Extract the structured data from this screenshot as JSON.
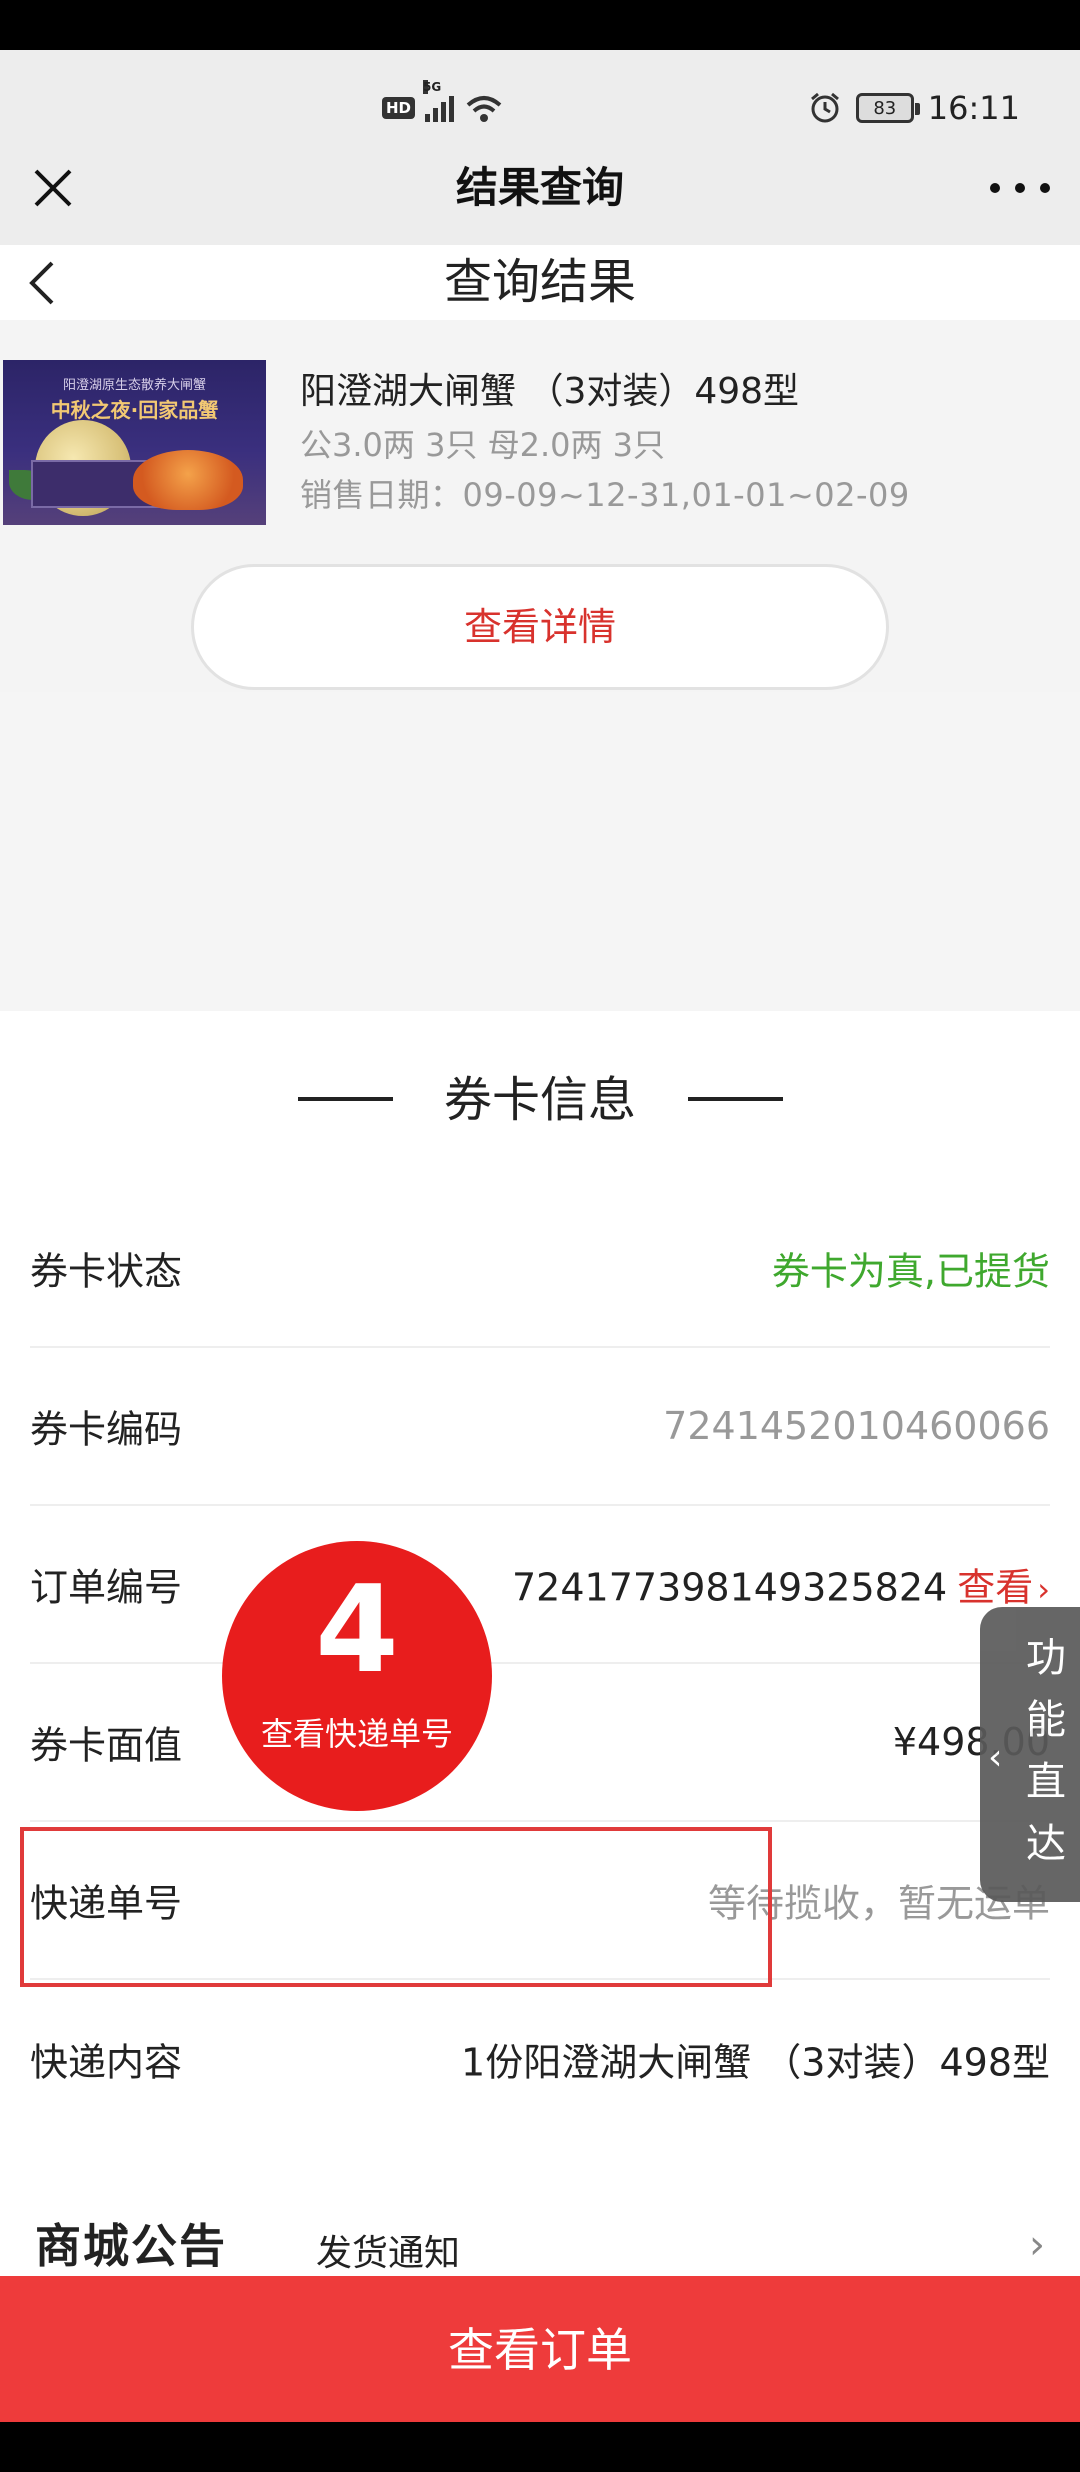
{
  "status_bar": {
    "hd": "HD",
    "network": "5G",
    "battery": "83",
    "time": "16:11"
  },
  "wechat_nav": {
    "title": "结果查询"
  },
  "page": {
    "title": "查询结果"
  },
  "product": {
    "image_subtitle": "阳澄湖原生态散养大闸蟹",
    "image_heading": "中秋之夜·回家品蟹",
    "name": "阳澄湖大闸蟹 （3对装）498型",
    "spec": "公3.0两 3只 母2.0两 3只",
    "sale_date": "销售日期：09-09~12-31,01-01~02-09",
    "detail_button": "查看详情"
  },
  "card_info": {
    "title": "券卡信息",
    "rows": [
      {
        "label": "券卡状态",
        "value": "券卡为真,已提货"
      },
      {
        "label": "券卡编码",
        "value": "7241452010460066"
      },
      {
        "label": "订单编号",
        "value": "724177398149325824",
        "action": "查看"
      },
      {
        "label": "券卡面值",
        "value": "¥498.00"
      },
      {
        "label": "快递单号",
        "value": "等待揽收，暂无运单"
      },
      {
        "label": "快递内容",
        "value": "1份阳澄湖大闸蟹 （3对装）498型"
      }
    ]
  },
  "annotation": {
    "step_number": "4",
    "step_text": "查看快递单号"
  },
  "side_tab": {
    "chars": [
      "功",
      "能",
      "直",
      "达"
    ]
  },
  "notice": {
    "logo": "商城公告",
    "text": "发货通知"
  },
  "bottom_button": "查看订单",
  "colors": {
    "accent_red": "#d8322d",
    "button_red": "#ee3b3b",
    "status_green": "#3fa82e"
  }
}
